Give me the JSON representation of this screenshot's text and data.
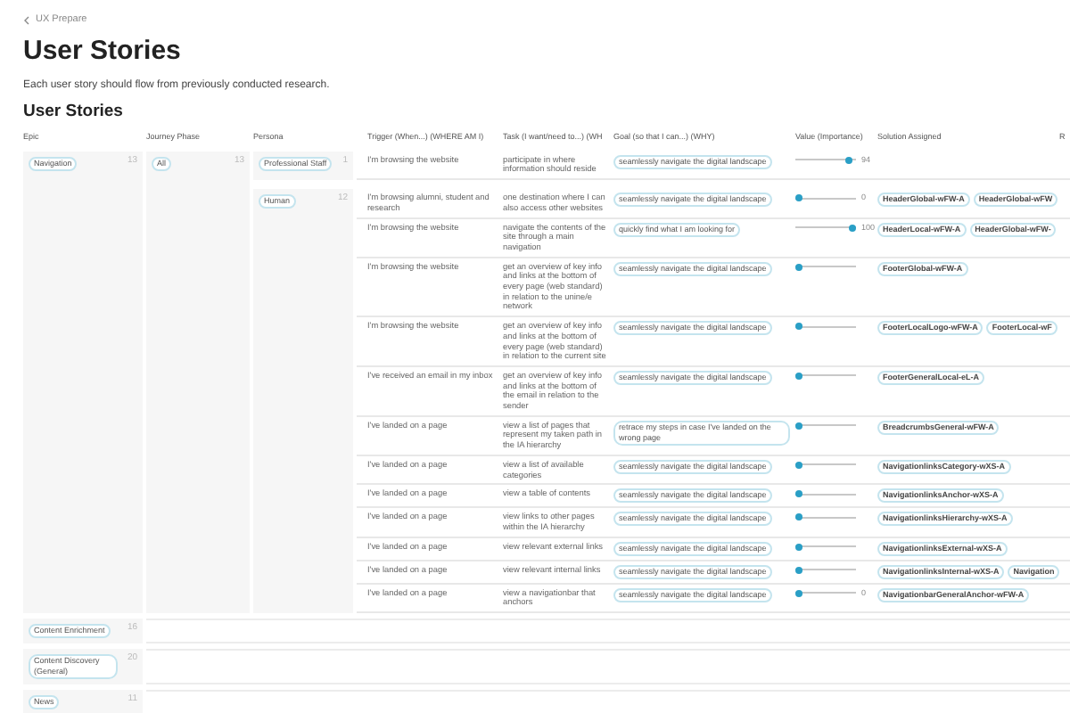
{
  "breadcrumb": "UX Prepare",
  "title": "User Stories",
  "description": "Each user story should flow from previously conducted research.",
  "section_title": "User Stories",
  "columns": [
    "Epic",
    "Journey Phase",
    "Persona",
    "Trigger (When...) (WHERE AM I)",
    "Task (I want/need to...) (WH",
    "Goal (so that I can...) (WHY)",
    "Value (Importance)",
    "Solution Assigned",
    "R"
  ],
  "epics": [
    {
      "name": "Navigation",
      "count": "13",
      "phases": [
        {
          "name": "All",
          "count": "13",
          "personas": [
            {
              "name": "Professional Staff",
              "count": "1",
              "stories": [
                {
                  "trigger": "I'm browsing the website",
                  "task": "participate in where information should reside",
                  "goal": "seamlessly navigate the digital landscape",
                  "value": {
                    "level": 0.94,
                    "reading": "94"
                  }
                }
              ]
            },
            {
              "name": "Human",
              "count": "12",
              "stories": [
                {
                  "trigger": "I'm browsing alumni, student and research",
                  "task": "one destination where I can also access other websites",
                  "goal": "seamlessly navigate the digital landscape",
                  "value": {
                    "level": 0,
                    "reading": "0"
                  },
                  "solutions": [
                    "HeaderGlobal-wFW-A",
                    "HeaderGlobal-wFW"
                  ]
                },
                {
                  "trigger": "I'm browsing the website",
                  "task": "navigate the contents of the site through a main navigation",
                  "goal": "quickly find what I am looking for",
                  "value": {
                    "level": 1,
                    "reading": "100"
                  },
                  "solutions": [
                    "HeaderLocal-wFW-A",
                    "HeaderGlobal-wFW-"
                  ]
                },
                {
                  "trigger": "I'm browsing the website",
                  "task": "get an overview of key info and links at the bottom of every page (web standard) in relation to the unine/e network",
                  "goal": "seamlessly navigate the digital landscape",
                  "value": {
                    "level": 0
                  },
                  "solutions": [
                    "FooterGlobal-wFW-A"
                  ]
                },
                {
                  "trigger": "I'm browsing the website",
                  "task": "get an overview of key info and links at the bottom of every page (web standard) in relation to the current site",
                  "goal": "seamlessly navigate the digital landscape",
                  "value": {
                    "level": 0
                  },
                  "solutions": [
                    "FooterLocalLogo-wFW-A",
                    "FooterLocal-wF"
                  ]
                },
                {
                  "trigger": "I've received an email in my inbox",
                  "task": "get an overview of key info and links at the bottom of the email in relation to the sender",
                  "goal": "seamlessly navigate the digital landscape",
                  "value": {
                    "level": 0
                  },
                  "solutions": [
                    "FooterGeneralLocal-eL-A"
                  ]
                },
                {
                  "trigger": "I've landed on a page",
                  "task": "view a list of pages that represent my taken path in the IA hierarchy",
                  "goal": "retrace my steps in case I've landed on the wrong page",
                  "value": {
                    "level": 0
                  },
                  "solutions": [
                    "BreadcrumbsGeneral-wFW-A"
                  ]
                },
                {
                  "trigger": "I've landed on a page",
                  "task": "view a list of available categories",
                  "goal": "seamlessly navigate the digital landscape",
                  "value": {
                    "level": 0
                  },
                  "solutions": [
                    "NavigationlinksCategory-wXS-A"
                  ]
                },
                {
                  "trigger": "I've landed on a page",
                  "task": "view a table of contents",
                  "goal": "seamlessly navigate the digital landscape",
                  "value": {
                    "level": 0
                  },
                  "solutions": [
                    "NavigationlinksAnchor-wXS-A"
                  ]
                },
                {
                  "trigger": "I've landed on a page",
                  "task": "view links to other pages within the IA hierarchy",
                  "goal": "seamlessly navigate the digital landscape",
                  "value": {
                    "level": 0
                  },
                  "solutions": [
                    "NavigationlinksHierarchy-wXS-A"
                  ]
                },
                {
                  "trigger": "I've landed on a page",
                  "task": "view relevant external links",
                  "goal": "seamlessly navigate the digital landscape",
                  "value": {
                    "level": 0
                  },
                  "solutions": [
                    "NavigationlinksExternal-wXS-A"
                  ]
                },
                {
                  "trigger": "I've landed on a page",
                  "task": "view relevant internal links",
                  "goal": "seamlessly navigate the digital landscape",
                  "value": {
                    "level": 0
                  },
                  "solutions": [
                    "NavigationlinksInternal-wXS-A",
                    "Navigation"
                  ]
                },
                {
                  "trigger": "I've landed on a page",
                  "task": "view a navigationbar that anchors",
                  "goal": "seamlessly navigate the digital landscape",
                  "value": {
                    "level": 0,
                    "reading": "0"
                  },
                  "solutions": [
                    "NavigationbarGeneralAnchor-wFW-A"
                  ]
                }
              ]
            }
          ]
        }
      ]
    },
    {
      "name": "Content Enrichment",
      "count": "16"
    },
    {
      "name": "Content Discovery (General)",
      "count": "20"
    },
    {
      "name": "News",
      "count": "11"
    }
  ]
}
